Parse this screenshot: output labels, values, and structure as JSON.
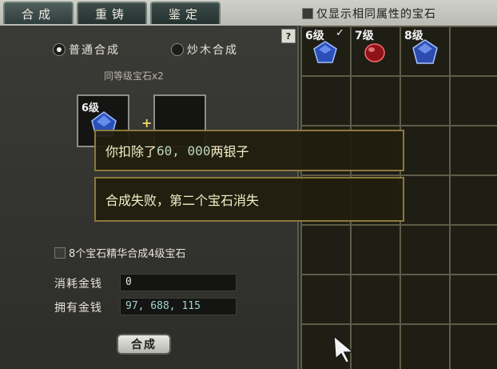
{
  "tabs": [
    {
      "label": "合成"
    },
    {
      "label": "重铸"
    },
    {
      "label": "鉴定"
    }
  ],
  "filter": {
    "label": "仅显示相同属性的宝石",
    "checked": false
  },
  "help": {
    "label": "?"
  },
  "modes": [
    {
      "label": "普通合成",
      "selected": true
    },
    {
      "label": "炒木合成",
      "selected": false
    }
  ],
  "subtitle": "同等级宝石x2",
  "slots": [
    {
      "level": "6级",
      "gem": "blue-gem-icon"
    },
    {
      "level": "",
      "gem": ""
    }
  ],
  "plus": "+",
  "essence": {
    "label": "8个宝石精华合成4级宝石",
    "checked": false
  },
  "cost": {
    "label": "消耗金钱",
    "value": "0"
  },
  "owned": {
    "label": "拥有金钱",
    "value": "97, 688, 115"
  },
  "confirm": {
    "label": "合成"
  },
  "inventory": [
    {
      "level": "6级",
      "gem": "blue-gem-icon",
      "marked": "✓"
    },
    {
      "level": "7级",
      "gem": "red-gem-icon"
    },
    {
      "level": "8级",
      "gem": "blue-gem-icon"
    }
  ],
  "messages": [
    {
      "prefix": "你扣除了",
      "amount": "60, 000",
      "suffix": "两银子"
    },
    {
      "text": "合成失败，第二个宝石消失"
    }
  ],
  "colors": {
    "accent_text": "#b8d8b8",
    "popup_border": "#8a7a3e"
  }
}
